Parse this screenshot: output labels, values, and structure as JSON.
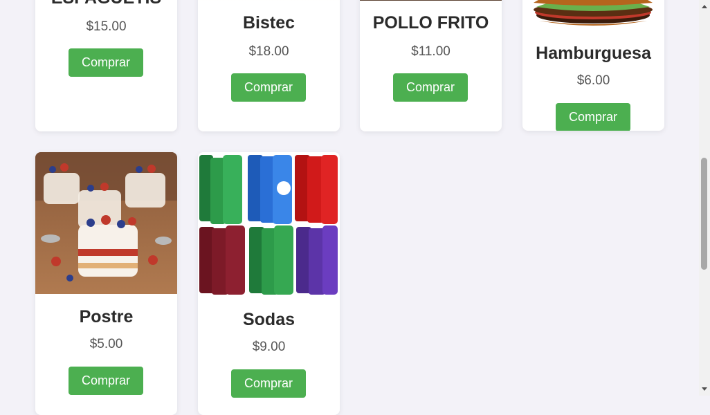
{
  "products": [
    {
      "name": "ESPAGUETIS",
      "price": "$15.00",
      "button": "Comprar"
    },
    {
      "name": "Bistec",
      "price": "$18.00",
      "button": "Comprar"
    },
    {
      "name": "POLLO FRITO",
      "price": "$11.00",
      "button": "Comprar"
    },
    {
      "name": "Hamburguesa",
      "price": "$6.00",
      "button": "Comprar"
    },
    {
      "name": "Postre",
      "price": "$5.00",
      "button": "Comprar"
    },
    {
      "name": "Sodas",
      "price": "$9.00",
      "button": "Comprar"
    }
  ],
  "colors": {
    "button": "#4caf50",
    "background": "#f3f2f8",
    "card": "#ffffff"
  },
  "icons": [
    "scroll-up-arrow-icon",
    "scroll-down-arrow-icon"
  ]
}
